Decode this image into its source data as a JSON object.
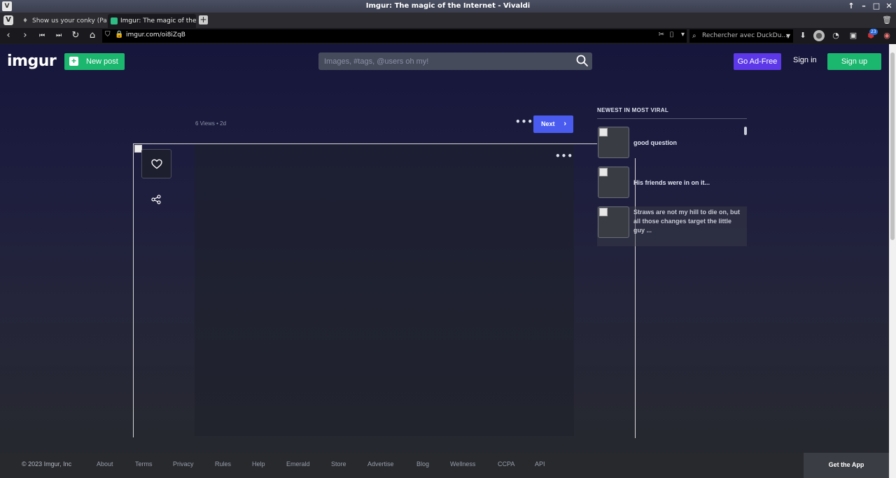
{
  "window": {
    "title": "Imgur: The magic of the Internet - Vivaldi"
  },
  "tabs": [
    {
      "label": "Show us your conky (Page"
    },
    {
      "label": "Imgur: The magic of the Int"
    }
  ],
  "addressbar": {
    "url": "imgur.com/oi8iZqB",
    "search_placeholder": "Rechercher avec DuckDu...",
    "extension_badge": "23"
  },
  "header": {
    "logo": "imgur",
    "new_post": "New post",
    "search_placeholder": "Images, #tags, @users oh my!",
    "ad_free": "Go Ad-Free",
    "sign_in": "Sign in",
    "sign_up": "Sign up"
  },
  "post": {
    "views": "6 Views",
    "separator": "•",
    "age": "2d",
    "more": "•••",
    "next": "Next",
    "next_icon": "›"
  },
  "sidebar": {
    "heading": "NEWEST IN MOST VIRAL",
    "items": [
      {
        "caption": "good question"
      },
      {
        "caption": "His friends were in on it..."
      },
      {
        "caption": "Straws are not my hill to die on, but all those changes target the little guy ..."
      }
    ]
  },
  "footer": {
    "copyright": "© 2023 Imgur, Inc",
    "links": [
      "About",
      "Terms",
      "Privacy",
      "Rules",
      "Help",
      "Emerald",
      "Store",
      "Advertise",
      "Blog",
      "Wellness",
      "CCPA",
      "API"
    ],
    "get_app": "Get the App"
  },
  "colors": {
    "green": "#1bb76e",
    "purple": "#5c38e8",
    "next_blue": "#4a5cf0"
  }
}
